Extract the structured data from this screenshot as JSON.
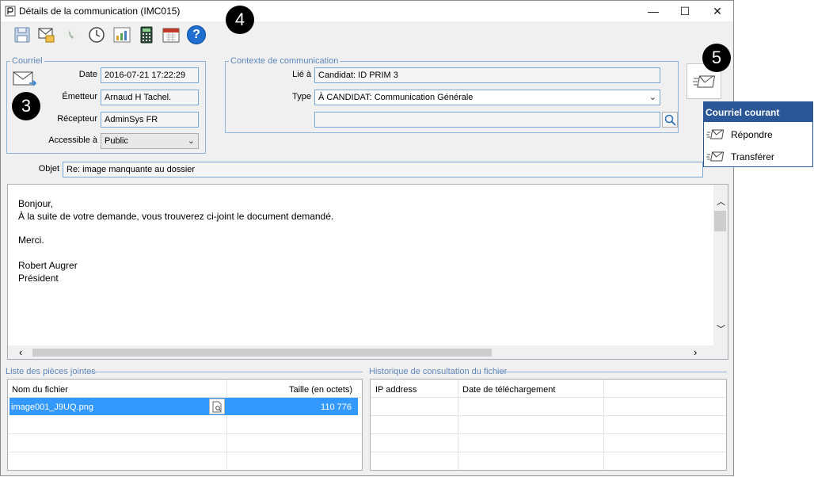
{
  "window": {
    "title": "Détails de la communication (IMC015)",
    "minimize": "—",
    "maximize": "☐",
    "close": "✕"
  },
  "toolbar": {
    "icons": [
      "save-icon",
      "email-icon",
      "phone-icon",
      "history-icon",
      "chart-icon",
      "calculator-icon",
      "calendar-icon",
      "help-icon"
    ],
    "help_glyph": "?"
  },
  "courriel": {
    "group_title": "Courriel",
    "date_label": "Date",
    "date_value": "2016-07-21 17:22:29",
    "emetteur_label": "Émetteur",
    "emetteur_value": "Arnaud H Tachel.",
    "recepteur_label": "Récepteur",
    "recepteur_value": "AdminSys FR",
    "accessible_label": "Accessible à",
    "accessible_value": "Public"
  },
  "contexte": {
    "group_title": "Contexte de communication",
    "lie_label": "Lié à",
    "lie_value": "Candidat: ID PRIM 3",
    "type_label": "Type",
    "type_value": "À CANDIDAT: Communication Générale",
    "extra_value": ""
  },
  "objet": {
    "label": "Objet",
    "value": "Re: image manquante au dossier"
  },
  "message": {
    "lines": [
      "Bonjour,",
      "À la suite de votre demande, vous trouverez ci-joint le document demandé.",
      "",
      "Merci.",
      "",
      "Robert Augrer",
      "Président"
    ]
  },
  "attachments": {
    "group_title": "Liste des pièces jointes",
    "col_name": "Nom du fichier",
    "col_size": "Taille (en octets)",
    "rows": [
      {
        "name": "image001_J9UQ.png",
        "size": "110 776"
      }
    ]
  },
  "history": {
    "group_title": "Historique de consultation du fichier",
    "col_ip": "IP address",
    "col_date": "Date de téléchargement"
  },
  "popup": {
    "header": "Courriel courant",
    "items": [
      "Répondre",
      "Transférer"
    ]
  },
  "badges": [
    "3",
    "4",
    "5"
  ],
  "colors": {
    "accent": "#2b5797",
    "selection": "#3399ff",
    "group_border": "#91b4d8"
  }
}
